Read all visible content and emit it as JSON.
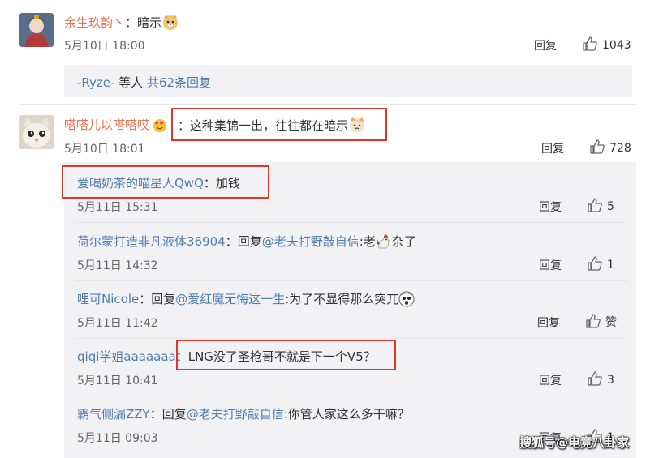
{
  "comment_top": {
    "username": "余生玖韵丶",
    "text": "：暗示",
    "time": "5月10日 18:00",
    "reply_label": "回复",
    "likes": "1043"
  },
  "reply_summary": {
    "username": "-Ryze-",
    "text_mid": " 等人 ",
    "link": "共62条回复"
  },
  "comment_main": {
    "username": "嗒嗒儿以嗒嗒哎",
    "text": "：这种集锦一出，往往都在暗示",
    "time": "5月10日 18:01",
    "reply_label": "回复",
    "likes": "728"
  },
  "replies": [
    {
      "username": "爱喝奶茶的喵星人QwQ",
      "prefix": "",
      "mention": "",
      "text": "：加钱",
      "time": "5月11日 15:31",
      "reply_label": "回复",
      "likes": "5"
    },
    {
      "username": "荷尔蒙打造非凡液体36904",
      "prefix": "：回复",
      "mention": "@老夫打野敲自信",
      "text": ":老",
      "suffix": "杂了",
      "time": "5月11日 14:32",
      "reply_label": "回复",
      "likes": "1"
    },
    {
      "username": "哩可Nicole",
      "prefix": "：回复",
      "mention": "@爱红魔无悔这一生",
      "text": ":为了不显得那么突兀",
      "time": "5月11日 11:42",
      "reply_label": "回复",
      "likes": "赞"
    },
    {
      "username": "qiqi学姐aaaaaaa",
      "prefix": "",
      "mention": "",
      "text": "：LNG没了圣枪哥不就是下一个V5？",
      "time": "5月11日 10:41",
      "reply_label": "回复",
      "likes": "3"
    },
    {
      "username": "霸气侧漏ZZY",
      "prefix": "：回复",
      "mention": "@老夫打野敲自信",
      "text": ":你管人家这么多干嘛？",
      "time": "5月11日 09:03",
      "reply_label": "回复",
      "likes": "1"
    }
  ],
  "watermark": "搜狐号@电竞八卦家"
}
